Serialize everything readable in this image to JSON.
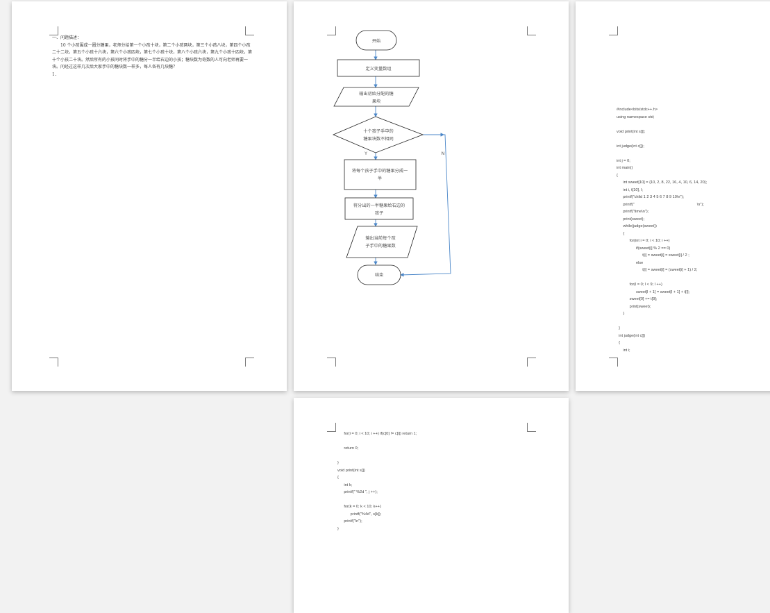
{
  "page1": {
    "heading": "一、问题描述：",
    "paragraph": "10 个小孩围成一圈分糖果，老师分给第一个小孩十块，第二个小孩两块，第三个小孩八块，第四个小孩二十二块，第五个小孩十六块，第六个小孩四块，第七个小孩十块，第八个小孩六块，第九个小孩十四块，第十个小孩二十块。然后所有的小孩同时将手中的糖分一半给右边的小孩；糖块数为奇数的人可向老师再要一块。问经过这样几次后大家手中的糖块数一样多，每人各有几块糖？",
    "item": "1．"
  },
  "flowchart": {
    "start": "开始",
    "define": "定义变量数组",
    "output_initial": [
      "输出初始分配的糖",
      "果块"
    ],
    "decision": [
      "十个孩子手中的",
      "糖果块数不相同"
    ],
    "yes": "Y",
    "no": "N",
    "split": [
      "将每个孩子手中的糖果分成一",
      "半"
    ],
    "give": [
      "将分出的一半糖果给右边的",
      "孩子"
    ],
    "output_current": [
      "输出当前每个孩",
      "子手中的糖果数"
    ],
    "end": "结束"
  },
  "page3_code": [
    "#include<bits/stdc++.h>",
    "using namespace std;",
    "",
    "void print(int s[]);",
    "",
    "int judge(int c[]);",
    "",
    "int j = 0;",
    "int main()",
    "{",
    "      int sweet[10] = {10, 2, 8, 22, 16, 4, 10, 6, 14, 20};",
    "      int i, t[10], l;",
    "      printf(\"child 1 2 3 4 5 6 7 8 9 10\\n\");",
    "      printf(\"                                                          \\n\");",
    "      printf(\"time\\n\");",
    "      print(sweet);",
    "      while(judge(sweet))",
    "      {",
    "            for(int i = 0; i < 10; i ++)",
    "                  if(sweet[i] % 2 == 0)",
    "                        t[i] = sweet[i] = sweet[i] / 2 ;",
    "                  else",
    "                        t[i] = sweet[i] = (sweet[i] + 1) / 2;",
    "",
    "            for(l = 0; l < 9; l ++)",
    "                  sweet[l + 1] = sweet[l + 1] + t[l];",
    "            sweet[0] += t[9];",
    "            print(sweet);",
    "      }",
    "",
    "  }",
    "  int judge(int c[])",
    "  {",
    "      int i;"
  ],
  "page4_code": [
    "      for(i = 0; i < 10; i ++) if(c[0] != c[i]) return 1;",
    "",
    "      return 0;",
    "",
    "}",
    "void print(int s[])",
    "{",
    "      int k;",
    "      printf(\" %2d \", j ++);",
    "",
    "      for(k = 0; k < 10; k++)",
    "            printf(\"%4d\", s[k]);",
    "      printf(\"\\n\");",
    "}"
  ]
}
